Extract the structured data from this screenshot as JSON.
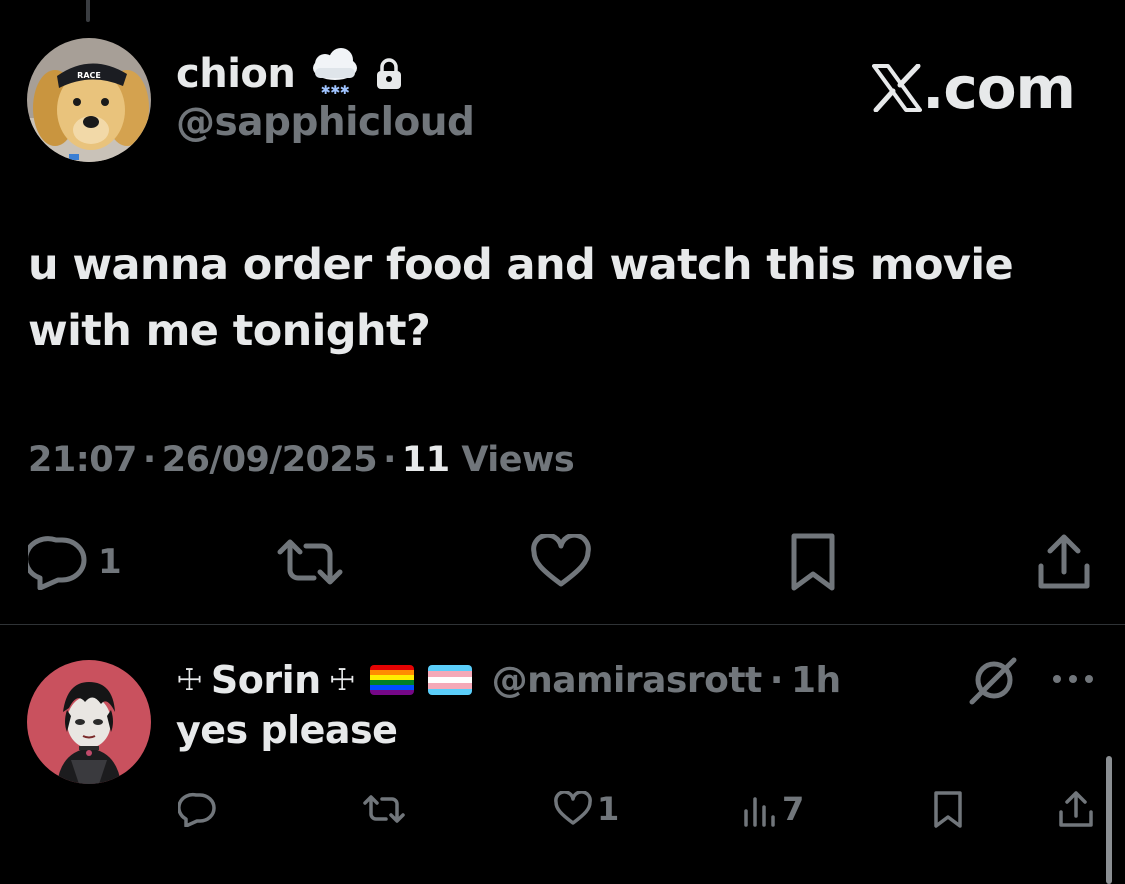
{
  "watermark": {
    "text": ".com"
  },
  "tweet": {
    "author": {
      "name": "chion",
      "handle": "@sapphicloud",
      "name_icons": [
        "snow-cloud-icon",
        "lock-icon"
      ]
    },
    "text": "u wanna order food and watch this movie with me tonight?",
    "time": "21:07",
    "date": "26/09/2025",
    "views_count": "11",
    "views_label": "Views",
    "actions": {
      "replies": "1",
      "reposts": "",
      "likes": "",
      "icons": [
        "reply-icon",
        "repost-icon",
        "like-icon",
        "bookmark-icon",
        "share-icon"
      ]
    }
  },
  "reply": {
    "author": {
      "name": "Sorin",
      "decoration": "☩",
      "flags": [
        "rainbow-flag-icon",
        "transgender-flag-icon"
      ],
      "handle": "@namirasrott",
      "time": "1h"
    },
    "text": "yes please",
    "actions": {
      "replies": "",
      "reposts": "",
      "likes": "1",
      "views": "7",
      "icons": [
        "reply-icon",
        "repost-icon",
        "like-icon",
        "analytics-icon",
        "bookmark-icon",
        "share-icon"
      ]
    }
  },
  "colors": {
    "background": "#000000",
    "primary_text": "#e7e9ea",
    "secondary_text": "#71767b",
    "divider": "#2f3336"
  }
}
